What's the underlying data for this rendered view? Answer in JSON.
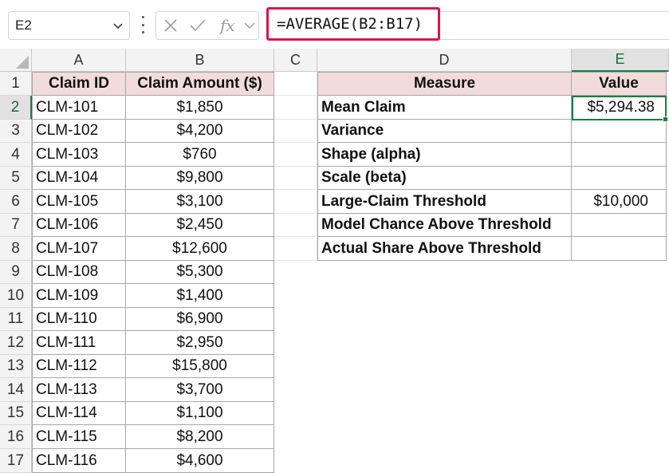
{
  "formula_bar": {
    "name_box": "E2",
    "fx_label": "fx",
    "formula": "=AVERAGE(B2:B17)"
  },
  "columns": [
    "A",
    "B",
    "C",
    "D",
    "E"
  ],
  "row_numbers": [
    "1",
    "2",
    "3",
    "4",
    "5",
    "6",
    "7",
    "8",
    "9",
    "10",
    "11",
    "12",
    "13",
    "14",
    "15",
    "16",
    "17"
  ],
  "claims_table": {
    "headers": [
      "Claim ID",
      "Claim Amount ($)"
    ],
    "rows": [
      [
        "CLM-101",
        "$1,850"
      ],
      [
        "CLM-102",
        "$4,200"
      ],
      [
        "CLM-103",
        "$760"
      ],
      [
        "CLM-104",
        "$9,800"
      ],
      [
        "CLM-105",
        "$3,100"
      ],
      [
        "CLM-106",
        "$2,450"
      ],
      [
        "CLM-107",
        "$12,600"
      ],
      [
        "CLM-108",
        "$5,300"
      ],
      [
        "CLM-109",
        "$1,400"
      ],
      [
        "CLM-110",
        "$6,900"
      ],
      [
        "CLM-111",
        "$2,950"
      ],
      [
        "CLM-112",
        "$15,800"
      ],
      [
        "CLM-113",
        "$3,700"
      ],
      [
        "CLM-114",
        "$1,100"
      ],
      [
        "CLM-115",
        "$8,200"
      ],
      [
        "CLM-116",
        "$4,600"
      ]
    ]
  },
  "measures_table": {
    "headers": [
      "Measure",
      "Value"
    ],
    "rows": [
      [
        "Mean Claim",
        "$5,294.38"
      ],
      [
        "Variance",
        ""
      ],
      [
        "Shape (alpha)",
        ""
      ],
      [
        "Scale (beta)",
        ""
      ],
      [
        "Large-Claim Threshold",
        "$10,000"
      ],
      [
        "Model Chance Above Threshold",
        ""
      ],
      [
        "Actual Share Above Threshold",
        ""
      ]
    ]
  },
  "active_cell": "E2",
  "colors": {
    "header_fill": "#f2dcdb",
    "selection": "#1d7a44",
    "formula_highlight": "#d6184a"
  }
}
